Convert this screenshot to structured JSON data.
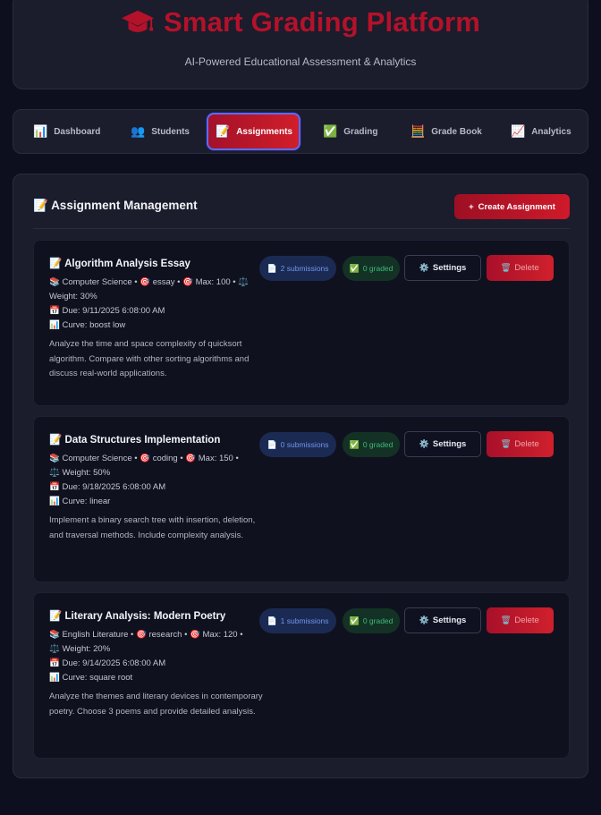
{
  "header": {
    "title": "Smart Grading Platform",
    "subtitle": "AI-Powered Educational Assessment & Analytics",
    "logo_icon": "graduation-cap-icon",
    "brand_color": "#b3122a"
  },
  "nav": {
    "tabs": [
      {
        "icon": "📊",
        "label": "Dashboard"
      },
      {
        "icon": "👥",
        "label": "Students"
      },
      {
        "icon": "📝",
        "label": "Assignments",
        "active": true
      },
      {
        "icon": "✅",
        "label": "Grading"
      },
      {
        "icon": "🧮",
        "label": "Grade Book"
      },
      {
        "icon": "📈",
        "label": "Analytics"
      }
    ]
  },
  "section": {
    "icon": "📝",
    "title": "Assignment Management",
    "create_icon": "+",
    "create_label": "Create Assignment"
  },
  "assignments": [
    {
      "title": "Algorithm Analysis Essay",
      "meta_line1": "📚 Computer Science • 🎯 essay • 🎯 Max: 100 • ⚖️",
      "meta_line2": "Weight: 30%",
      "due": "📅 Due: 9/11/2025 6:08:00 AM",
      "curve": "📊 Curve: boost low",
      "description": "Analyze the time and space complexity of quicksort algorithm. Compare with other sorting algorithms and discuss real-world applications.",
      "submissions": "2 submissions",
      "graded": "0 graded",
      "settings_label": "Settings",
      "delete_label": "Delete"
    },
    {
      "title": "Data Structures Implementation",
      "meta_line1": "📚 Computer Science • 🎯 coding • 🎯 Max: 150 •",
      "meta_line2": "⚖️ Weight: 50%",
      "due": "📅 Due: 9/18/2025 6:08:00 AM",
      "curve": "📊 Curve: linear",
      "description": "Implement a binary search tree with insertion, deletion, and traversal methods. Include complexity analysis.",
      "submissions": "0 submissions",
      "graded": "0 graded",
      "settings_label": "Settings",
      "delete_label": "Delete"
    },
    {
      "title": "Literary Analysis: Modern Poetry",
      "meta_line1": "📚 English Literature • 🎯 research • 🎯 Max: 120 •",
      "meta_line2": "⚖️ Weight: 20%",
      "due": "📅 Due: 9/14/2025 6:08:00 AM",
      "curve": "📊 Curve: square root",
      "description": "Analyze the themes and literary devices in contemporary poetry. Choose 3 poems and provide detailed analysis.",
      "submissions": "1 submissions",
      "graded": "0 graded",
      "settings_label": "Settings",
      "delete_label": "Delete"
    }
  ]
}
